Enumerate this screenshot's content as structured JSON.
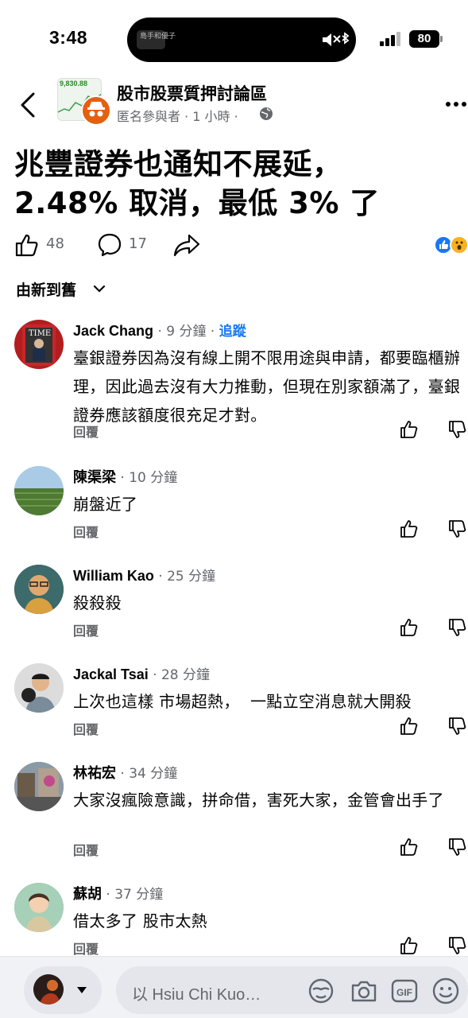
{
  "status_bar": {
    "time": "3:48",
    "battery": "80",
    "island_text": "島手和優子"
  },
  "header": {
    "group_name": "股市股票質押討論區",
    "meta": "匿名參與者 · 1 小時 ·",
    "thumb_number": "9,830.88"
  },
  "post": {
    "title_line1": "兆豐證券也通知不展延，",
    "title_line2": "2.48% 取消，最低 3% 了",
    "likes": "48",
    "comments": "17"
  },
  "sort_label": "由新到舊",
  "reply_label": "回覆",
  "follow_label": "追蹤",
  "comments": [
    {
      "name": "Jack Chang",
      "time": " · 9 分鐘 · ",
      "text": "臺銀證券因為沒有線上開不限用途與申請，都要臨櫃辦理，因此過去沒有大力推動，但現在別家額滿了，臺銀證券應該額度很充足才對。"
    },
    {
      "name": "陳渠梁",
      "time": " · 10 分鐘",
      "text": "崩盤近了"
    },
    {
      "name": "William Kao",
      "time": " · 25 分鐘",
      "text": "殺殺殺"
    },
    {
      "name": "Jackal Tsai",
      "time": " · 28 分鐘",
      "text": "上次也這樣 市場超熱，  一點立空消息就大開殺"
    },
    {
      "name": "林祐宏",
      "time": " · 34 分鐘",
      "text": "大家沒瘋險意識，拼命借，害死大家，金管會出手了"
    },
    {
      "name": "蘇胡",
      "time": " · 37 分鐘",
      "text": "借太多了 股市太熱"
    }
  ],
  "composer": {
    "placeholder": "以 Hsiu Chi Kuo…"
  },
  "colors": {
    "accent": "#1877f2",
    "muted": "#65676b",
    "anon": "#e4600f"
  }
}
